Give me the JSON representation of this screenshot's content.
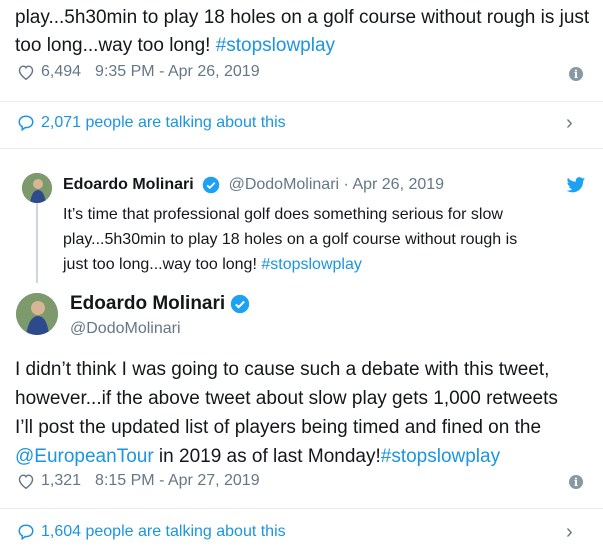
{
  "tweet1": {
    "text_part": "play...5h30min to play 18 holes on a golf course without rough is just too long...way too long! ",
    "hashtag": "#stopslowplay",
    "likes": "6,494",
    "timestamp": "9:35 PM - Apr 26, 2019",
    "talking": "2,071 people are talking about this"
  },
  "quoted": {
    "name": "Edoardo Molinari",
    "handle": "@DodoMolinari",
    "sep": "·",
    "date": "Apr 26, 2019",
    "line1": "It’s time that professional golf does something serious for slow",
    "line2": "play...5h30min to play 18 holes on a golf course without rough is",
    "line3": "just too long...way too long! ",
    "hashtag": "#stopslowplay"
  },
  "tweet2": {
    "name": "Edoardo Molinari",
    "handle": "@DodoMolinari",
    "line1": "I didn’t think I was going to cause such a debate with this tweet,",
    "line2": "however...if the above tweet about slow play gets 1,000 retweets",
    "line3": "I’ll post the updated list of players being timed and fined on the",
    "mention": "@EuropeanTour",
    "line4_mid": " in 2019 as of last Monday!",
    "hashtag": "#stopslowplay",
    "likes": "1,321",
    "timestamp": "8:15 PM - Apr 27, 2019",
    "talking": "1,604 people are talking about this"
  },
  "colors": {
    "link": "#1b95e0",
    "muted": "#657786",
    "text": "#14171a",
    "twitter": "#1da1f2"
  }
}
